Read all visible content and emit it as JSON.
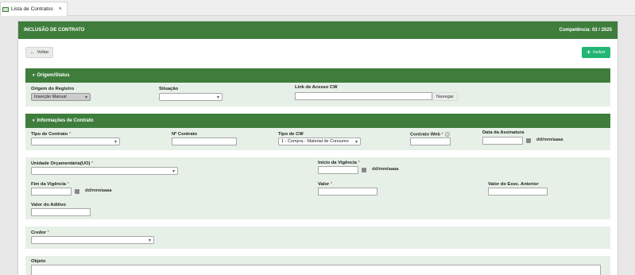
{
  "tab": {
    "title": "Lista de Contratos",
    "close": "×"
  },
  "header": {
    "title": "INCLUSÃO DE CONTRATO",
    "competencia": "Competência: 03 / 2025"
  },
  "toolbar": {
    "back_label": "Voltar",
    "back_icon": "←",
    "add_label": "Incluir",
    "add_icon": "+"
  },
  "origem": {
    "title": "Origem/Status",
    "origem_label": "Origem do Registro",
    "origem_value": "Inserção Manual",
    "situacao_label": "Situação",
    "situacao_value": "",
    "link_label": "Link de Acesso CW",
    "link_value": "",
    "navegar_label": "Navegar"
  },
  "contrato": {
    "title": "Informações de Contrato",
    "tipo_contrato_label": "Tipo de Contrato",
    "tipo_contrato_value": "",
    "num_contrato_label": "Nº Contrato",
    "num_contrato_value": "",
    "tipo_cw_label": "Tipo de CW",
    "tipo_cw_value": "1 - Compra - Material de Consumo",
    "contrato_web_label": "Contrato Web",
    "contrato_web_value": "",
    "data_assinatura_label": "Data da Assinatura",
    "date_format": "dd/mm/aaaa"
  },
  "orcamento": {
    "uo_label": "Unidade Orçamentária(UO)",
    "uo_value": "",
    "inicio_label": "Início da Vigência",
    "fim_label": "Fim da Vigência",
    "valor_label": "Valor",
    "valor_anterior_label": "Valor do Exec. Anterior",
    "aditivo_label": "Valor do Aditivo"
  },
  "credor": {
    "label": "Credor",
    "value": ""
  },
  "objeto": {
    "label": "Objeto",
    "value": ""
  },
  "required_mark": "*",
  "help_mark": "?",
  "caret": "▾",
  "section_marker": "▾",
  "colors": {
    "primary_green": "#3e7d3c",
    "button_green": "#22b573",
    "section_bg": "#e6f0e6",
    "required": "#c0392b"
  }
}
